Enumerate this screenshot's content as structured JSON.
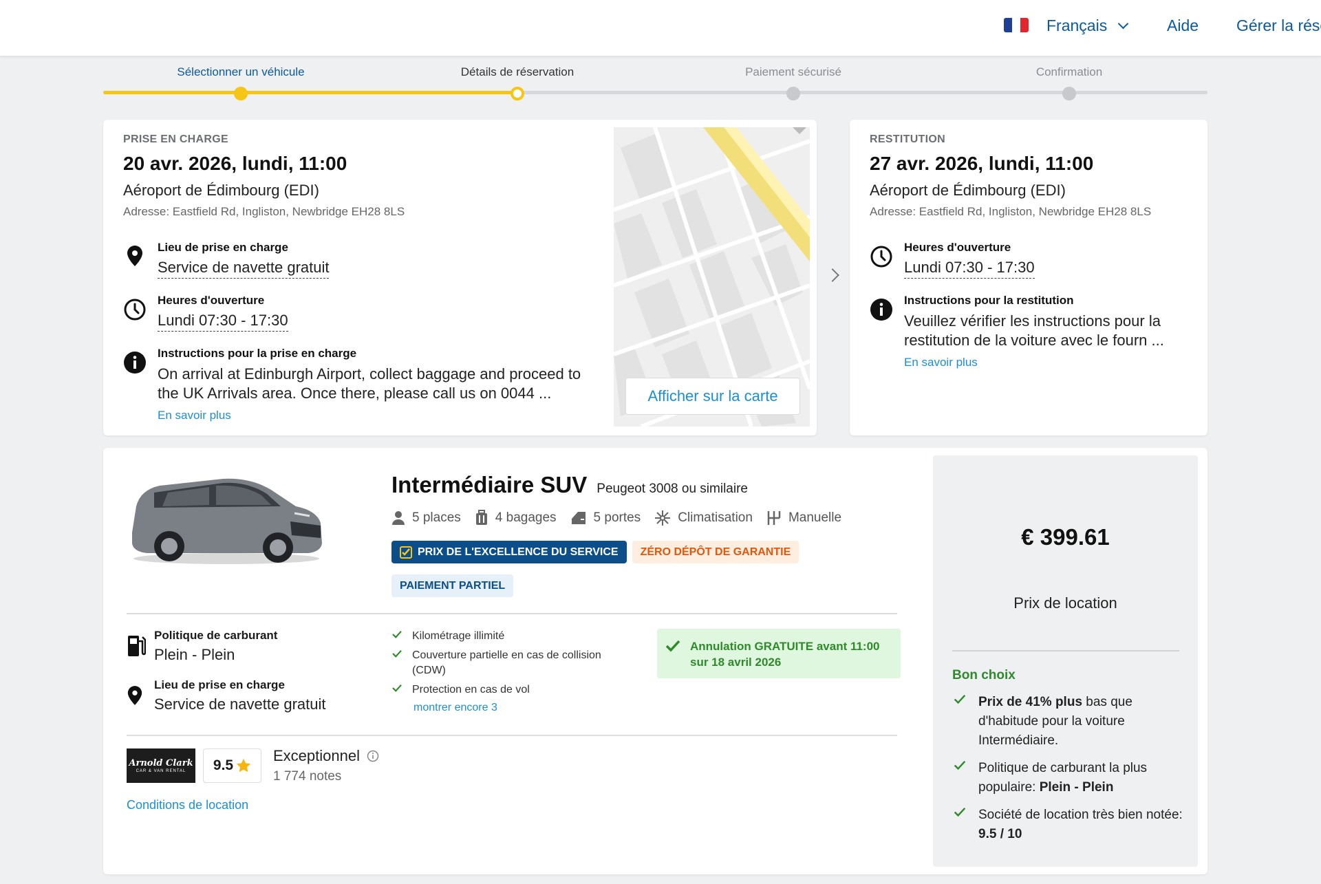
{
  "header": {
    "language": "Français",
    "flag_colors": [
      "#1d3f95",
      "#ffffff",
      "#e1262d"
    ],
    "help": "Aide",
    "manage": "Gérer la rése"
  },
  "stepper": {
    "steps": [
      {
        "label": "Sélectionner un véhicule",
        "state": "done"
      },
      {
        "label": "Détails de réservation",
        "state": "current"
      },
      {
        "label": "Paiement sécurisé",
        "state": "todo"
      },
      {
        "label": "Confirmation",
        "state": "todo"
      }
    ]
  },
  "pickup": {
    "heading": "PRISE EN CHARGE",
    "date": "20 avr. 2026, lundi, 11:00",
    "location": "Aéroport de Édimbourg (EDI)",
    "address": "Adresse: Eastfield Rd, Ingliston, Newbridge EH28 8LS",
    "place_title": "Lieu de prise en charge",
    "place_value": "Service de navette gratuit",
    "hours_title": "Heures d'ouverture",
    "hours_value": "Lundi 07:30 - 17:30",
    "instr_title": "Instructions pour la prise en charge",
    "instr_text": "On arrival at Edinburgh Airport, collect baggage and proceed to the UK Arrivals area. Once there, please call us on 0044 ...",
    "more": "En savoir plus",
    "map_button": "Afficher sur la carte"
  },
  "dropoff": {
    "heading": "RESTITUTION",
    "date": "27 avr. 2026, lundi, 11:00",
    "location": "Aéroport de Édimbourg (EDI)",
    "address": "Adresse: Eastfield Rd, Ingliston, Newbridge EH28 8LS",
    "hours_title": "Heures d'ouverture",
    "hours_value": "Lundi 07:30 - 17:30",
    "instr_title": "Instructions pour la restitution",
    "instr_text": "Veuillez vérifier les instructions pour la restitution de la voiture avec le fourn ...",
    "more": "En savoir plus"
  },
  "car": {
    "category": "Intermédiaire SUV",
    "model": "Peugeot 3008 ou similaire",
    "specs": {
      "seats": "5 places",
      "bags": "4 bagages",
      "doors": "5 portes",
      "ac": "Climatisation",
      "transmission": "Manuelle"
    },
    "badges": {
      "excellence": "PRIX DE L'EXCELLENCE DU SERVICE",
      "deposit": "ZÉRO DÉPÔT DE GARANTIE",
      "partial": "PAIEMENT PARTIEL"
    },
    "fuel_title": "Politique de carburant",
    "fuel_value": "Plein - Plein",
    "place_title": "Lieu de prise en charge",
    "place_value": "Service de navette gratuit",
    "inclusions": [
      "Kilométrage illimité",
      "Couverture partielle en cas de collision (CDW)",
      "Protection en cas de vol"
    ],
    "show_more": "montrer encore 3",
    "cancellation": "Annulation GRATUITE avant 11:00 sur 18 avril 2026",
    "supplier_logo_line1": "Arnold Clark",
    "supplier_logo_line2": "CAR & VAN RENTAL",
    "score": "9.5",
    "rating_word": "Exceptionnel",
    "rating_count": "1 774 notes",
    "conditions": "Conditions de location"
  },
  "price": {
    "amount": "€ 399.61",
    "label": "Prix de location",
    "good_choice": "Bon choix",
    "reason1_bold": "Prix de 41% plus",
    "reason1_rest": " bas que d'habitude pour la voiture Intermédiaire.",
    "reason2_text": "Politique de carburant la plus populaire: ",
    "reason2_bold": "Plein - Plein",
    "reason3_text": "Société de location très bien notée: ",
    "reason3_bold": "9.5 / 10"
  }
}
